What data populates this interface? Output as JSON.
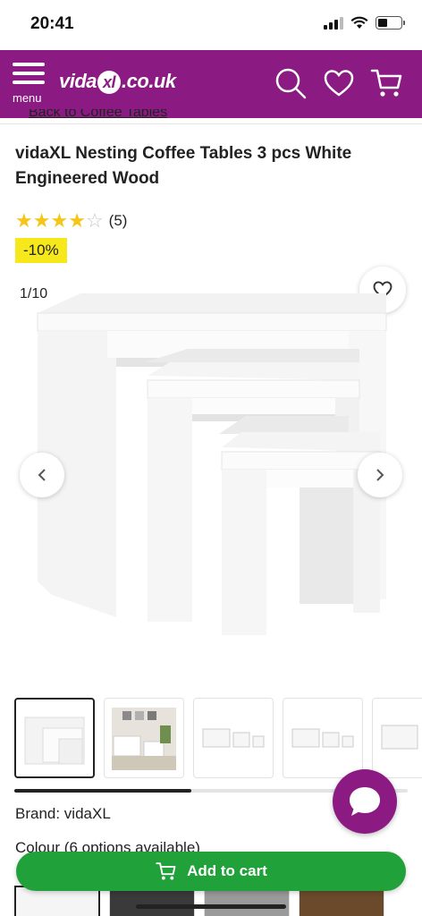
{
  "status_bar": {
    "time": "20:41"
  },
  "header": {
    "menu_label": "menu",
    "logo_text_left": "vida",
    "logo_text_x": "xl",
    "logo_text_right": ".co.uk",
    "icons": [
      "search-icon",
      "heart-icon",
      "cart-icon"
    ],
    "brand_color": "#8b1a82"
  },
  "breadcrumb": {
    "label": "Back to Coffee Tables"
  },
  "product": {
    "title": "vidaXL Nesting Coffee Tables 3 pcs White Engineered Wood",
    "rating": 4,
    "rating_max": 5,
    "review_count": "(5)",
    "discount": "-10%",
    "image_counter": "1/10",
    "brand": "Brand: vidaXL",
    "colour": "Colour (6 options available)"
  },
  "gallery": {
    "thumbnail_count_visible": 5,
    "progress_fraction": 0.45
  },
  "actions": {
    "add_to_cart": "Add to cart",
    "cta_color": "#21a13a"
  }
}
